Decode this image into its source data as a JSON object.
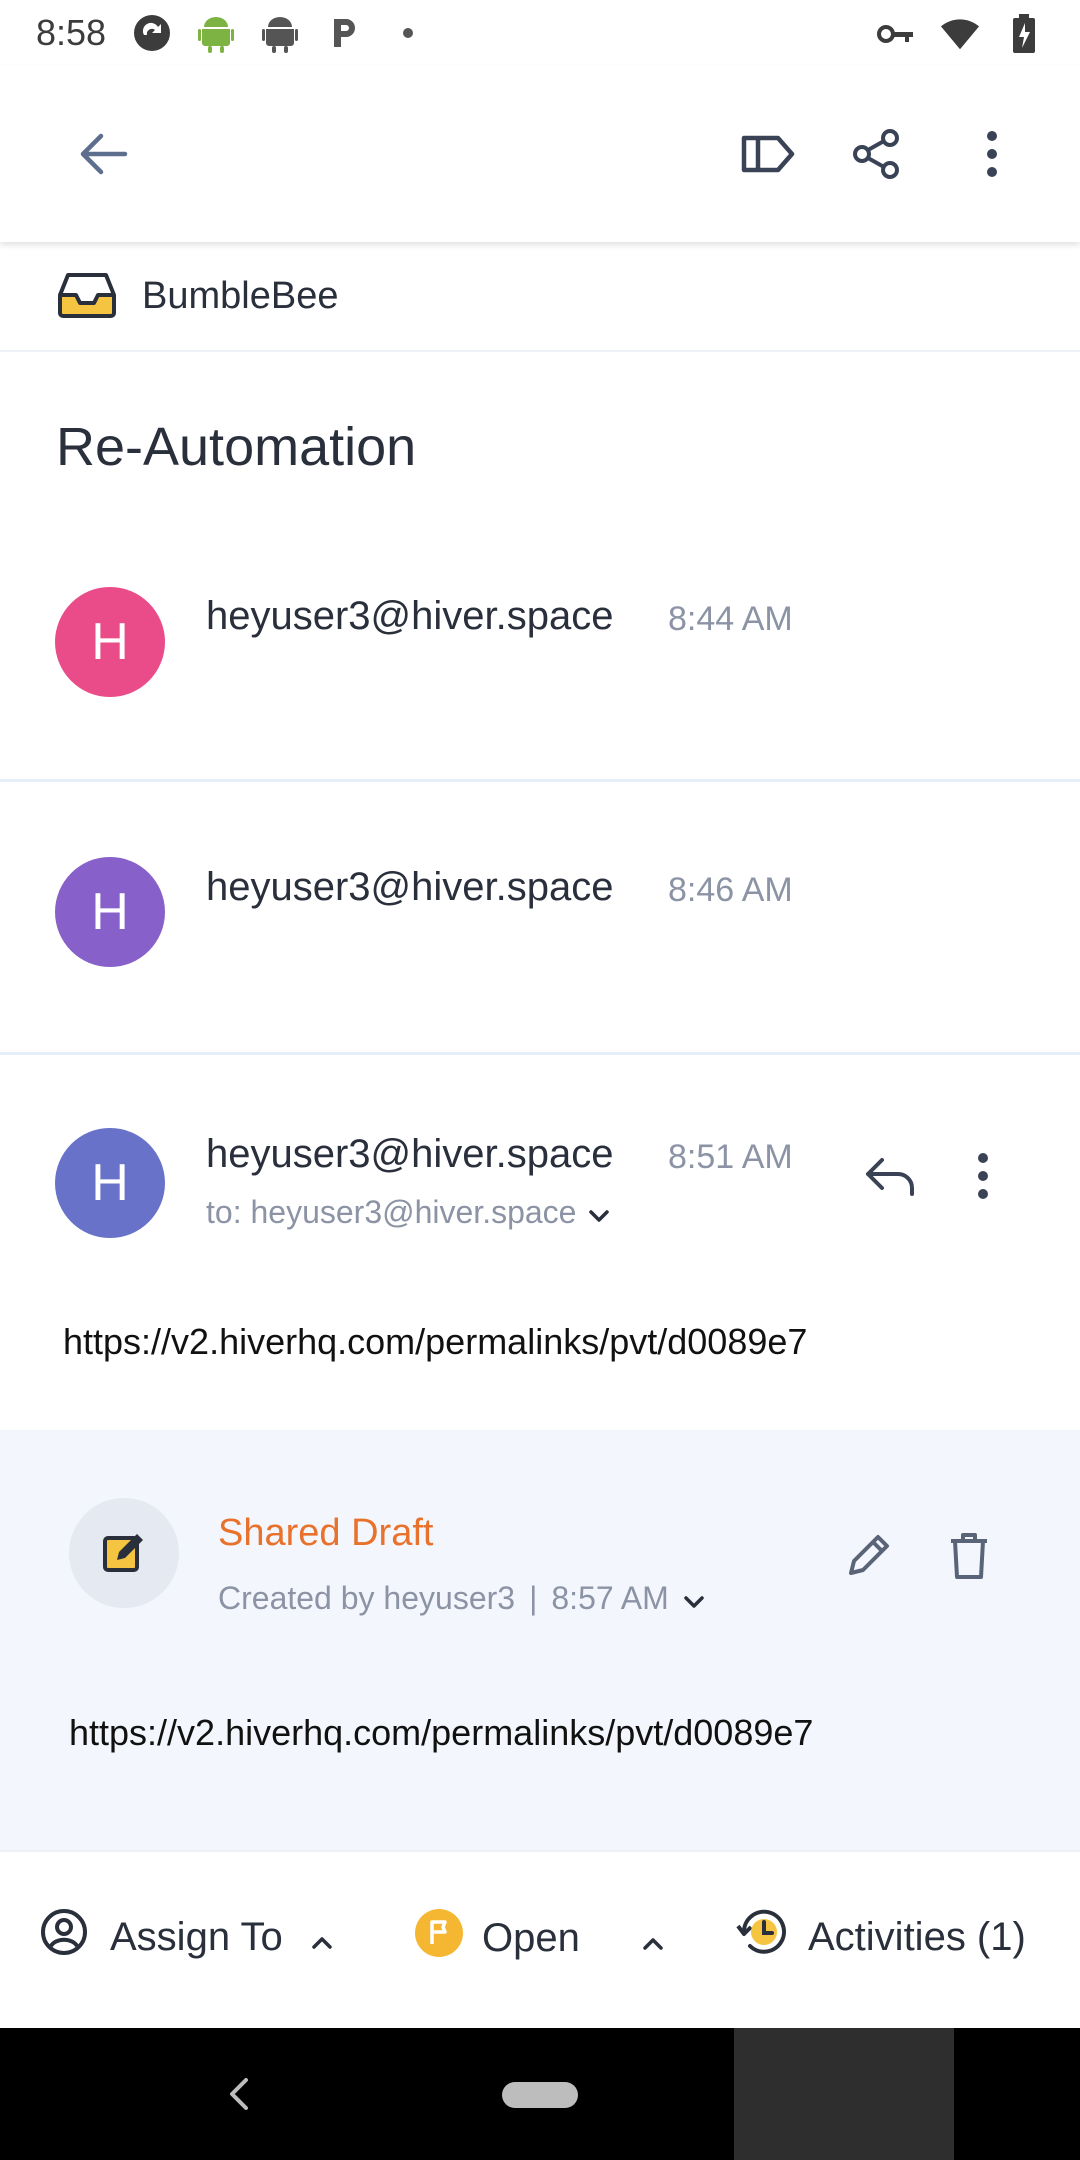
{
  "status_bar": {
    "time": "8:58",
    "left_icons": [
      "sync-icon",
      "android-icon",
      "android-icon",
      "p-icon",
      "dot-icon"
    ],
    "right_icons": [
      "vpn-key-icon",
      "wifi-icon",
      "battery-charging-icon"
    ]
  },
  "appbar": {
    "icons": [
      "back-arrow-icon",
      "label-icon",
      "share-icon",
      "more-vert-icon"
    ]
  },
  "inbox": {
    "name": "BumbleBee"
  },
  "conversation": {
    "subject": "Re-Automation",
    "messages": [
      {
        "sender": "heyuser3@hiver.space",
        "time": "8:44 AM",
        "avatar_letter": "H",
        "avatar_color": "#ea4c89"
      },
      {
        "sender": "heyuser3@hiver.space",
        "time": "8:46 AM",
        "avatar_letter": "H",
        "avatar_color": "#8860c9"
      },
      {
        "sender": "heyuser3@hiver.space",
        "time": "8:51 AM",
        "avatar_letter": "H",
        "avatar_color": "#6872c8",
        "to": "to: heyuser3@hiver.space",
        "body": "https://v2.hiverhq.com/permalinks/pvt/d0089e7"
      }
    ]
  },
  "shared_draft": {
    "title": "Shared Draft",
    "created_by": "Created by heyuser3",
    "separator": "|",
    "time": "8:57 AM",
    "body": "https://v2.hiverhq.com/permalinks/pvt/d0089e7",
    "title_color": "#e8722c"
  },
  "bottom_bar": {
    "assign_label": "Assign To",
    "status_label": "Open",
    "activities_label": "Activities (1)",
    "status_color": "#f5b731"
  }
}
